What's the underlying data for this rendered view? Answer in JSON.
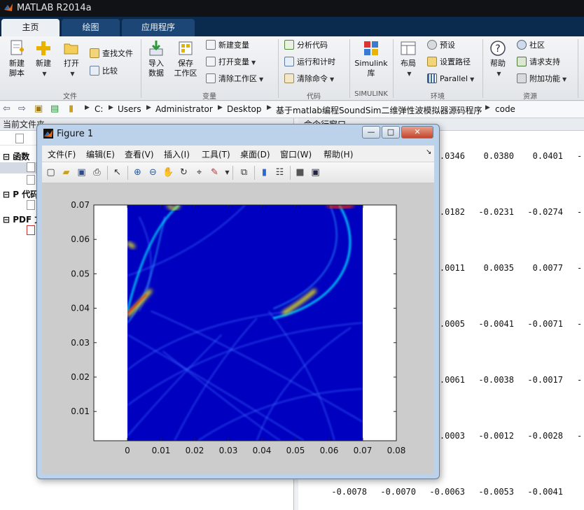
{
  "app": {
    "title": "MATLAB R2014a",
    "logo_icon": "matlab-logo-icon"
  },
  "tabs": [
    {
      "label": "主页",
      "active": true
    },
    {
      "label": "绘图",
      "active": false
    },
    {
      "label": "应用程序",
      "active": false
    }
  ],
  "ribbon": {
    "file": {
      "group_label": "文件",
      "new_script": "新建\n脚本",
      "new": "新建",
      "open": "打开",
      "find_files": "查找文件",
      "compare": "比较"
    },
    "variable": {
      "group_label": "变量",
      "import_data": "导入\n数据",
      "save_workspace": "保存\n工作区",
      "new_variable": "新建变量",
      "open_variable": "打开变量",
      "clear_workspace": "清除工作区"
    },
    "code": {
      "group_label": "代码",
      "analyze_code": "分析代码",
      "run_and_time": "运行和计时",
      "clear_commands": "清除命令"
    },
    "simulink": {
      "group_label": "SIMULINK",
      "library": "Simulink\n库"
    },
    "environment": {
      "group_label": "环境",
      "layout": "布局",
      "preferences": "预设",
      "set_path": "设置路径",
      "parallel": "Parallel"
    },
    "resources": {
      "group_label": "资源",
      "help": "帮助",
      "community": "社区",
      "request_support": "请求支持",
      "add_ons": "附加功能"
    }
  },
  "address": {
    "crumbs": [
      "C:",
      "Users",
      "Administrator",
      "Desktop",
      "基于matlab编程SoundSim二维弹性波模拟器源码程序",
      "code"
    ]
  },
  "left_panel": {
    "title": "当前文件夹",
    "sections": [
      "函数",
      "P 代码",
      "PDF 文"
    ]
  },
  "command_window": {
    "title": "命令行窗口",
    "rows": [
      {
        "values": [
          "0.0346",
          "0.0380",
          "0.0401"
        ]
      },
      {
        "values": [
          "0.0182",
          "-0.0231",
          "-0.0274"
        ]
      },
      {
        "values": [
          "0.0011",
          "0.0035",
          "0.0077"
        ]
      },
      {
        "values": [
          "0.0005",
          "-0.0041",
          "-0.0071"
        ]
      },
      {
        "values": [
          "0.0061",
          "-0.0038",
          "-0.0017"
        ]
      },
      {
        "values": [
          "0.0003",
          "-0.0012",
          "-0.0028"
        ]
      },
      {
        "values": [
          "-0.0078",
          "-0.0070",
          "-0.0063",
          "-0.0053",
          "-0.0041"
        ]
      }
    ]
  },
  "figure": {
    "title": "Figure 1",
    "controls": {
      "minimize": "—",
      "maximize": "□",
      "close": "✕"
    },
    "menu": [
      "文件(F)",
      "编辑(E)",
      "查看(V)",
      "插入(I)",
      "工具(T)",
      "桌面(D)",
      "窗口(W)",
      "帮助(H)"
    ],
    "toolbar_icons": [
      "new-figure-icon",
      "open-file-icon",
      "save-icon",
      "print-icon",
      "pointer-icon",
      "zoom-in-icon",
      "zoom-out-icon",
      "pan-icon",
      "rotate-icon",
      "data-cursor-icon",
      "brush-icon",
      "link-icon",
      "colorbar-icon",
      "legend-icon",
      "hide-plot-tools-icon",
      "show-plot-tools-icon"
    ]
  },
  "chart_data": {
    "type": "heatmap",
    "title": "",
    "xlabel": "",
    "ylabel": "",
    "xlim": [
      -0.01,
      0.08
    ],
    "ylim": [
      0.0015,
      0.07
    ],
    "x_ticks": [
      "0",
      "0.01",
      "0.02",
      "0.03",
      "0.04",
      "0.05",
      "0.06",
      "0.07",
      "0.08"
    ],
    "y_ticks": [
      "0.01",
      "0.02",
      "0.03",
      "0.04",
      "0.05",
      "0.06",
      "0.07"
    ],
    "image_extent_x": [
      0,
      0.07
    ],
    "colormap": "jet",
    "colors": {
      "background": "#0000c0",
      "hot": "#ff2a00",
      "warm": "#ffff00",
      "mid": "#00e0ff"
    }
  }
}
